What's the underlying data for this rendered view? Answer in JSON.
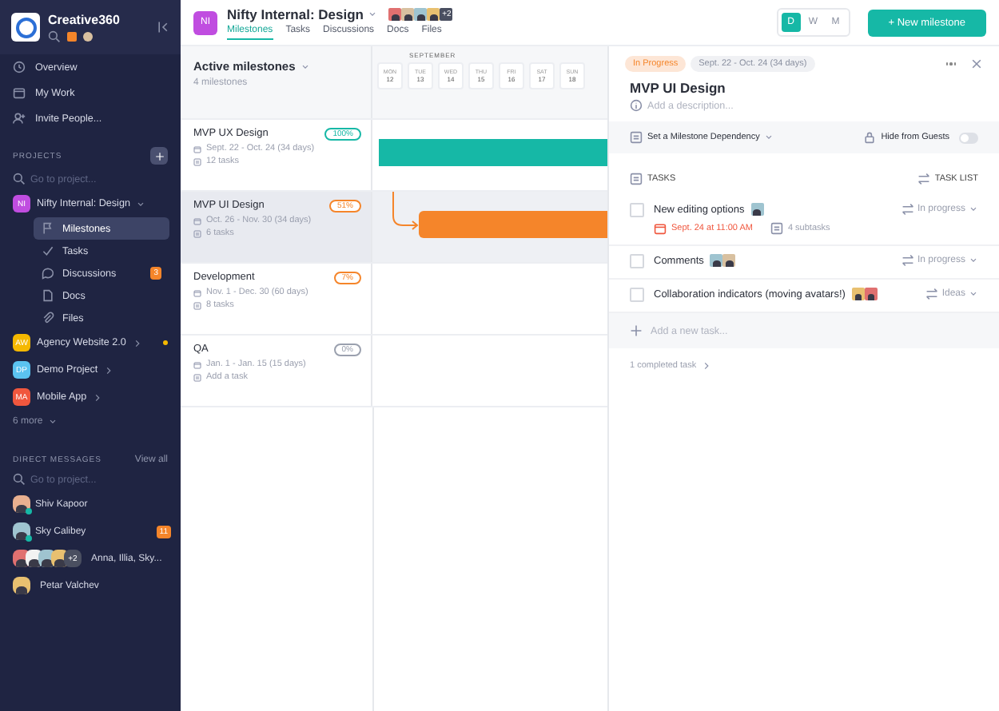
{
  "sidebar": {
    "workspace": "Creative360",
    "nav": [
      {
        "label": "Overview"
      },
      {
        "label": "My Work"
      },
      {
        "label": "Invite People..."
      }
    ],
    "projects_label": "PROJECTS",
    "projects_search": {
      "placeholder": "Go to project..."
    },
    "projects": [
      {
        "initials": "NI",
        "name": "Nifty Internal: Design",
        "color": "#c04de0",
        "expanded": true,
        "unread": false,
        "children": [
          {
            "label": "Milestones",
            "selected": true
          },
          {
            "label": "Tasks",
            "selected": false
          },
          {
            "label": "Discussions",
            "selected": false,
            "badge": "3"
          },
          {
            "label": "Docs",
            "selected": false
          },
          {
            "label": "Files",
            "selected": false
          }
        ]
      },
      {
        "initials": "AW",
        "name": "Agency Website 2.0",
        "color": "#f5b800",
        "expanded": false,
        "unread": true
      },
      {
        "initials": "DP",
        "name": "Demo Project",
        "color": "#5bc3f0",
        "expanded": false,
        "unread": false
      },
      {
        "initials": "MA",
        "name": "Mobile App",
        "color": "#f0573e",
        "expanded": false,
        "unread": false
      }
    ],
    "more": "6 more",
    "dm_label": "DIRECT MESSAGES",
    "dm_view_all": "View all",
    "dm_search": {
      "placeholder": "Go to project..."
    },
    "dms": [
      {
        "name": "Shiv Kapoor",
        "online": true
      },
      {
        "name": "Sky Calibey",
        "online": true,
        "badge": "11"
      },
      {
        "name": "Anna, Illia, Sky...",
        "online": false,
        "extra": "+2"
      },
      {
        "name": "Petar Valchev",
        "online": false
      }
    ]
  },
  "header": {
    "initials": "NI",
    "title": "Nifty Internal: Design",
    "avatar_extra": "+2",
    "tabs": [
      {
        "label": "Milestones",
        "selected": true
      },
      {
        "label": "Tasks",
        "selected": false
      },
      {
        "label": "Discussions",
        "selected": false
      },
      {
        "label": "Docs",
        "selected": false
      },
      {
        "label": "Files",
        "selected": false
      }
    ],
    "zoom": [
      {
        "label": "D",
        "selected": true
      },
      {
        "label": "W",
        "selected": false
      },
      {
        "label": "M",
        "selected": false
      }
    ],
    "new_button": "+ New milestone"
  },
  "milestones_panel": {
    "title": "Active milestones",
    "count": "4 milestones",
    "month": "SEPTEMBER",
    "days": [
      {
        "dow": "MON",
        "day": "12"
      },
      {
        "dow": "TUE",
        "day": "13"
      },
      {
        "dow": "WED",
        "day": "14"
      },
      {
        "dow": "THU",
        "day": "15"
      },
      {
        "dow": "FRI",
        "day": "16"
      },
      {
        "dow": "SAT",
        "day": "17"
      },
      {
        "dow": "SUN",
        "day": "18"
      }
    ],
    "milestones": [
      {
        "name": "MVP UX Design",
        "percent": "100%",
        "color": "#16b8a6",
        "dates": "Sept. 22 - Oct. 24 (34 days)",
        "tasks": "12 tasks",
        "selected": false,
        "bar": true
      },
      {
        "name": "MVP UI Design",
        "percent": "51%",
        "color": "#f5852a",
        "dates": "Oct. 26 - Nov. 30 (34 days)",
        "tasks": "6 tasks",
        "selected": true,
        "bar": true
      },
      {
        "name": "Development",
        "percent": "7%",
        "color": "#f5852a",
        "dates": "Nov. 1 - Dec. 30 (60 days)",
        "tasks": "8 tasks",
        "selected": false,
        "bar": false
      },
      {
        "name": "QA",
        "percent": "0%",
        "color": "#9aa0ae",
        "dates": "Jan. 1 - Jan. 15 (15 days)",
        "tasks": "Add a task",
        "selected": false,
        "bar": false
      }
    ]
  },
  "detail": {
    "status": "In Progress",
    "dates": "Sept. 22 - Oct. 24 (34 days)",
    "title": "MVP UI Design",
    "description": {
      "placeholder": "Add a description..."
    },
    "dependency": "Set a Milestone Dependency",
    "hide_guests": {
      "label": "Hide from Guests",
      "on": false
    },
    "tasks_label": "TASKS",
    "task_list": "TASK LIST",
    "tasks": [
      {
        "name": "New editing options",
        "checked": false,
        "status": "In progress",
        "due": "Sept. 24 at 11:00 AM",
        "subtasks": "4 subtasks"
      },
      {
        "name": "Comments",
        "checked": false,
        "status": "In progress"
      },
      {
        "name": "Collaboration indicators (moving avatars!)",
        "checked": false,
        "status": "Ideas"
      }
    ],
    "new_task": {
      "placeholder": "Add a new task..."
    },
    "completed": "1 completed task"
  }
}
